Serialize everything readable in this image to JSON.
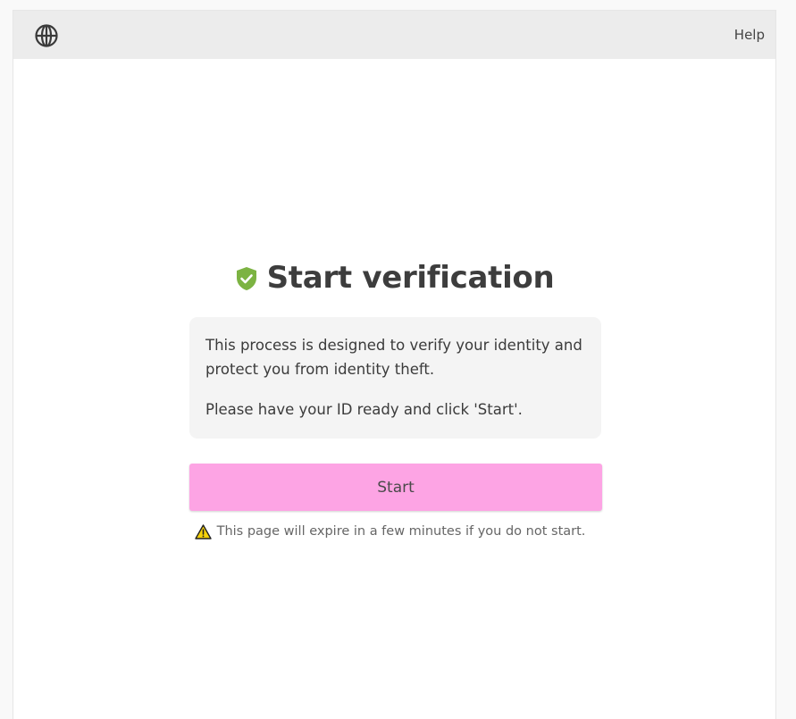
{
  "header": {
    "globe_icon": "globe-icon",
    "help_label": "Help"
  },
  "main": {
    "title_icon": "shield-check-icon",
    "title": "Start verification",
    "info_line_1": "This process is designed to verify your identity and protect you from identity theft.",
    "info_line_2": "Please have your ID ready and click 'Start'.",
    "start_label": "Start",
    "warning_icon": "warning-triangle-icon",
    "expire_note": "This page will expire in a few minutes if you do not start."
  },
  "colors": {
    "header_bg": "#ececec",
    "shield_green": "#7cb342",
    "start_button": "#fda4e4",
    "info_bg": "#f4f4f4",
    "warning_yellow": "#f5d10a"
  }
}
